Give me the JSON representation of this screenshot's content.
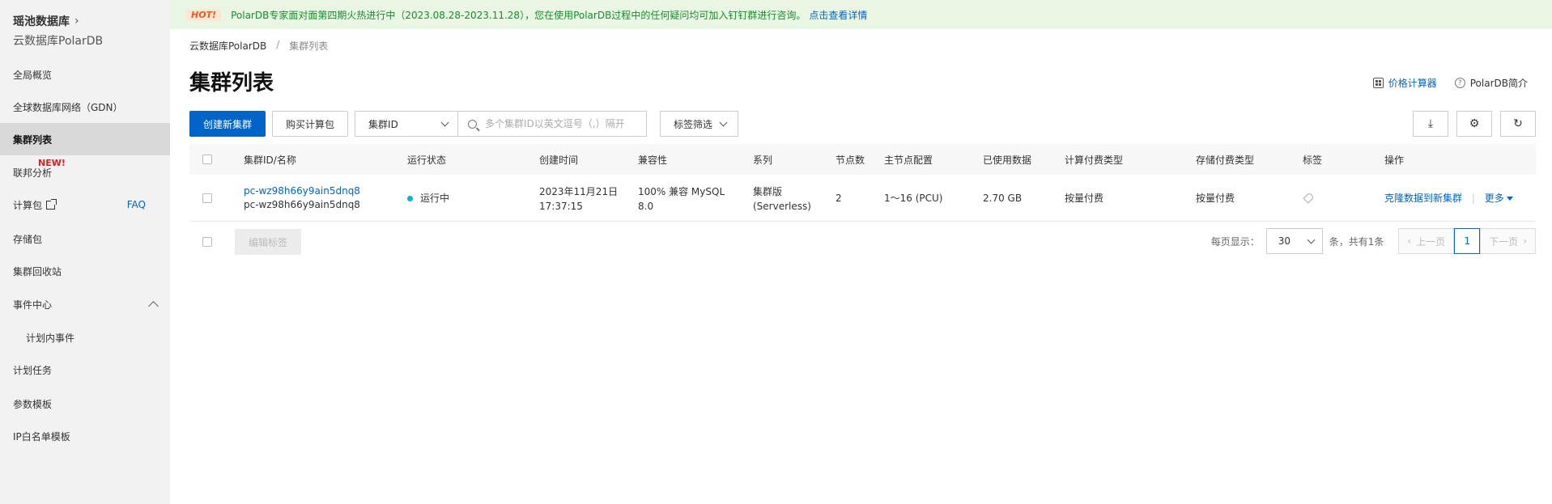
{
  "sidebar": {
    "product": "瑶池数据库",
    "subtitle": "云数据库PolarDB",
    "items": [
      {
        "label": "全局概览"
      },
      {
        "label": "全球数据库网络（GDN）"
      },
      {
        "label": "集群列表"
      },
      {
        "label": "联邦分析"
      },
      {
        "label": "计算包"
      },
      {
        "label": "存储包"
      },
      {
        "label": "集群回收站"
      },
      {
        "label": "事件中心"
      },
      {
        "label": "计划内事件"
      },
      {
        "label": "计划任务"
      },
      {
        "label": "参数模板"
      },
      {
        "label": "IP白名单模板"
      }
    ],
    "new_badge": "NEW!",
    "faq": "FAQ",
    "collapse_glyph": "‹"
  },
  "notice": {
    "hot": "HOT!",
    "text": "PolarDB专家面对面第四期火热进行中（2023.08.28-2023.11.28），您在使用PolarDB过程中的任何疑问均可加入钉钉群进行咨询。",
    "link": "点击查看详情"
  },
  "breadcrumb": {
    "root": "云数据库PolarDB",
    "sep": "/",
    "current": "集群列表"
  },
  "page_title": "集群列表",
  "top_links": {
    "price_calc": "价格计算器",
    "intro": "PolarDB简介",
    "intro_glyph": "?"
  },
  "toolbar": {
    "create": "创建新集群",
    "buy_package": "购买计算包",
    "filter_select": "集群ID",
    "search_placeholder": "多个集群ID以英文逗号（,）隔开",
    "tag_filter": "标签筛选",
    "download_glyph": "⤓",
    "settings_glyph": "⚙",
    "refresh_glyph": "↻"
  },
  "table": {
    "headers": {
      "id": "集群ID/名称",
      "status": "运行状态",
      "created": "创建时间",
      "compat": "兼容性",
      "series": "系列",
      "nodes": "节点数",
      "config": "主节点配置",
      "used": "已使用数据",
      "billing": "计算付费类型",
      "storage_billing": "存储付费类型",
      "tags": "标签",
      "ops": "操作"
    },
    "row": {
      "id": "pc-wz98h66y9ain5dnq8",
      "name": "pc-wz98h66y9ain5dnq8",
      "status": "运行中",
      "created_date": "2023年11月21日",
      "created_time": "17:37:15",
      "compat_1": "100% 兼容 MySQL",
      "compat_2": "8.0",
      "series_1": "集群版",
      "series_2": "(Serverless)",
      "nodes": "2",
      "config": "1～16 (PCU)",
      "used": "2.70 GB",
      "billing": "按量付费",
      "storage_billing": "按量付费",
      "op_clone": "克隆数据到新集群",
      "op_sep": "|",
      "op_more": "更多"
    },
    "edit_tags": "编辑标签",
    "status_color": "#00b8c8"
  },
  "pager": {
    "per_page_label": "每页显示：",
    "per_page": "30",
    "total": "条，共有1条",
    "prev": "上一页",
    "current": "1",
    "next": "下一页",
    "prev_glyph": "‹",
    "next_glyph": "›"
  },
  "colors": {
    "accent": "#0064c8",
    "notice_bg": "#eaf6e4",
    "notice_text": "#1a8a2e"
  }
}
